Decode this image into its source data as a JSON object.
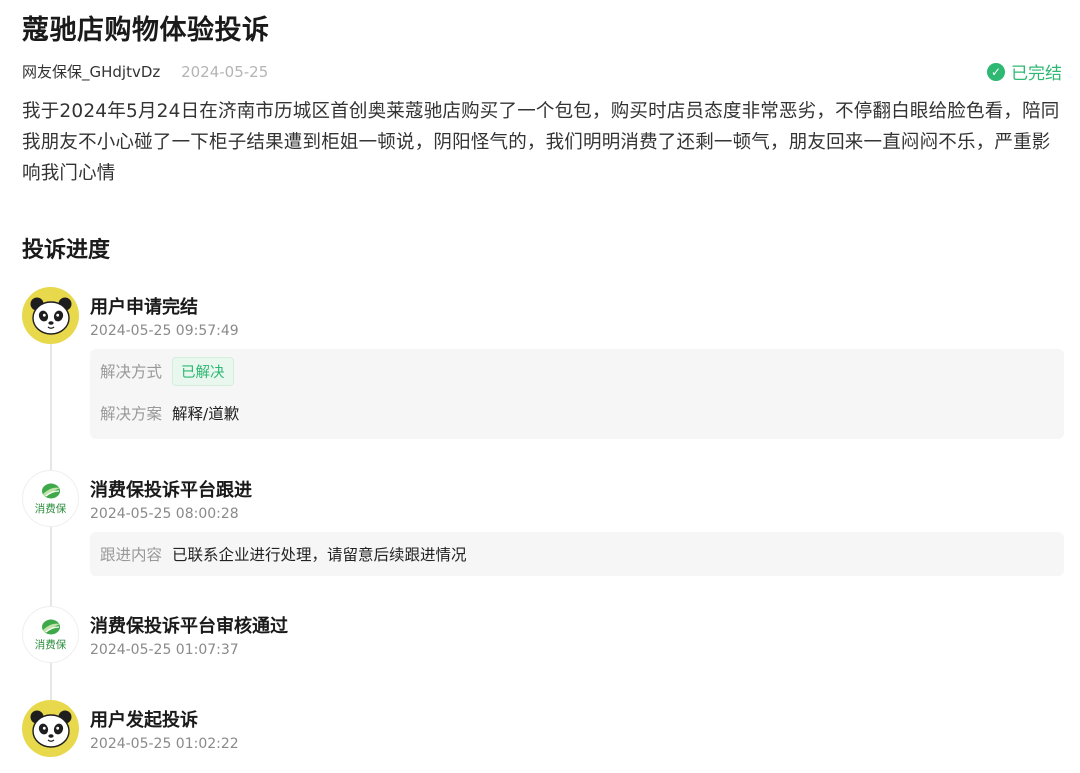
{
  "title": "蔻驰店购物体验投诉",
  "author": "网友保保_GHdjtvDz",
  "date": "2024-05-25",
  "status": "已完结",
  "description": "我于2024年5月24日在济南市历城区首创奥莱蔻驰店购买了一个包包，购买时店员态度非常恶劣，不停翻白眼给脸色看，陪同我朋友不小心碰了一下柜子结果遭到柜姐一顿说，阴阳怪气的，我们明明消费了还剩一顿气，朋友回来一直闷闷不乐，严重影响我门心情",
  "progress_title": "投诉进度",
  "timeline": [
    {
      "avatar": "panda-avatar",
      "title": "用户申请完结",
      "time": "2024-05-25 09:57:49",
      "details": [
        {
          "label": "解决方式",
          "value": "已解决",
          "tag": true
        },
        {
          "label": "解决方案",
          "value": "解释/道歉"
        }
      ]
    },
    {
      "avatar": "xiaofeibao-logo",
      "avatar_text": "消费保",
      "title": "消费保投诉平台跟进",
      "time": "2024-05-25 08:00:28",
      "details": [
        {
          "label": "跟进内容",
          "value": "已联系企业进行处理，请留意后续跟进情况"
        }
      ]
    },
    {
      "avatar": "xiaofeibao-logo",
      "avatar_text": "消费保",
      "title": "消费保投诉平台审核通过",
      "time": "2024-05-25 01:07:37"
    },
    {
      "avatar": "panda-avatar",
      "title": "用户发起投诉",
      "time": "2024-05-25 01:02:22"
    }
  ],
  "colors": {
    "accent_green": "#2eb872",
    "panda_bg": "#e8d84c"
  }
}
